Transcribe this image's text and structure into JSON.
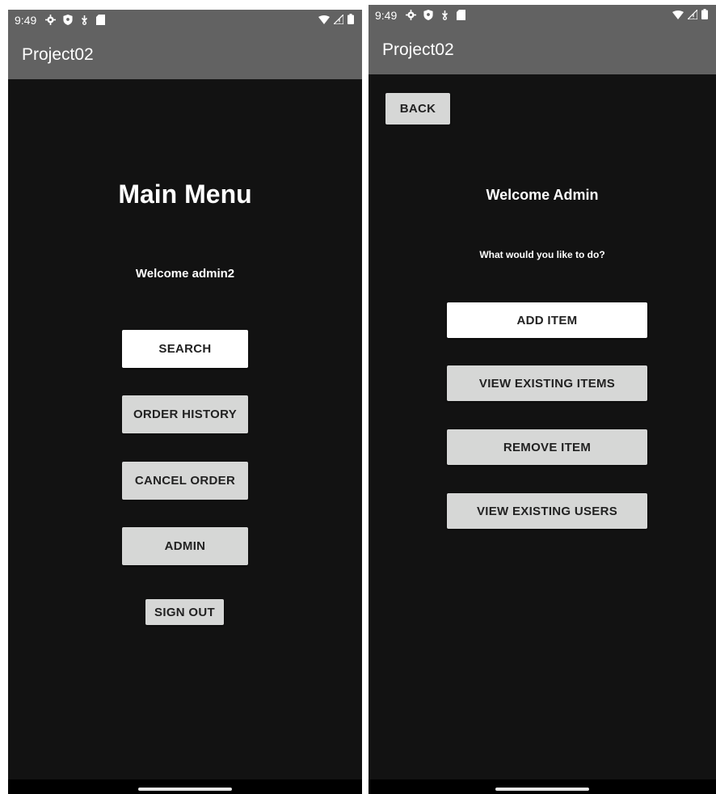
{
  "left_screen": {
    "status": {
      "time": "9:49"
    },
    "app_title": "Project02",
    "title": "Main Menu",
    "welcome": "Welcome admin2",
    "buttons": {
      "search": "SEARCH",
      "order_history": "ORDER HISTORY",
      "cancel_order": "CANCEL ORDER",
      "admin": "ADMIN",
      "sign_out": "SIGN OUT"
    }
  },
  "right_screen": {
    "status": {
      "time": "9:49"
    },
    "app_title": "Project02",
    "back_label": "BACK",
    "welcome": "Welcome Admin",
    "prompt": "What would you like to do?",
    "buttons": {
      "add_item": "ADD ITEM",
      "view_existing_items": "VIEW EXISTING ITEMS",
      "remove_item": "REMOVE ITEM",
      "view_existing_users": "VIEW EXISTING USERS"
    }
  },
  "colors": {
    "background": "#121212",
    "app_bar": "#626262",
    "button_grey": "#d6d7d6",
    "button_white": "#ffffff"
  },
  "icons": [
    "gear-icon",
    "shield-icon",
    "download-icon",
    "sd-card-icon",
    "wifi-icon",
    "signal-icon",
    "battery-icon"
  ]
}
